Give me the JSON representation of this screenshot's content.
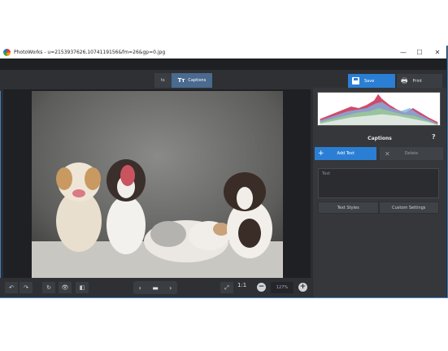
{
  "window": {
    "title": "PhotoWorks - u=2153937626,1074119156&fm=26&gp=0.jpg",
    "controls": {
      "minimize": "—",
      "maximize": "☐",
      "close": "✕"
    }
  },
  "toolbar": {
    "tab_partial_label": "ts",
    "tab_captions_icon": "Tт",
    "tab_captions_label": "Captions",
    "save_label": "Save",
    "print_label": "Print",
    "print_icon": "🖶"
  },
  "bottombar": {
    "undo": "↶",
    "redo": "↷",
    "rotate": "↻",
    "eye": "👁",
    "compare": "◧",
    "prev": "‹",
    "folder": "▬",
    "next": "›",
    "fit": "⤢",
    "ratio": "1:1",
    "zoom_out": "−",
    "zoom_value": "127%",
    "zoom_in": "+"
  },
  "panel": {
    "title": "Captions",
    "help": "?",
    "add_label": "Add Text",
    "add_icon": "+",
    "delete_label": "Delete",
    "delete_icon": "✕",
    "text_placeholder": "Text",
    "tab_text_styles": "Text Styles",
    "tab_custom_settings": "Custom Settings"
  },
  "colors": {
    "accent": "#2a7fd4",
    "bg": "#2b2d30",
    "panel": "#35373b"
  }
}
